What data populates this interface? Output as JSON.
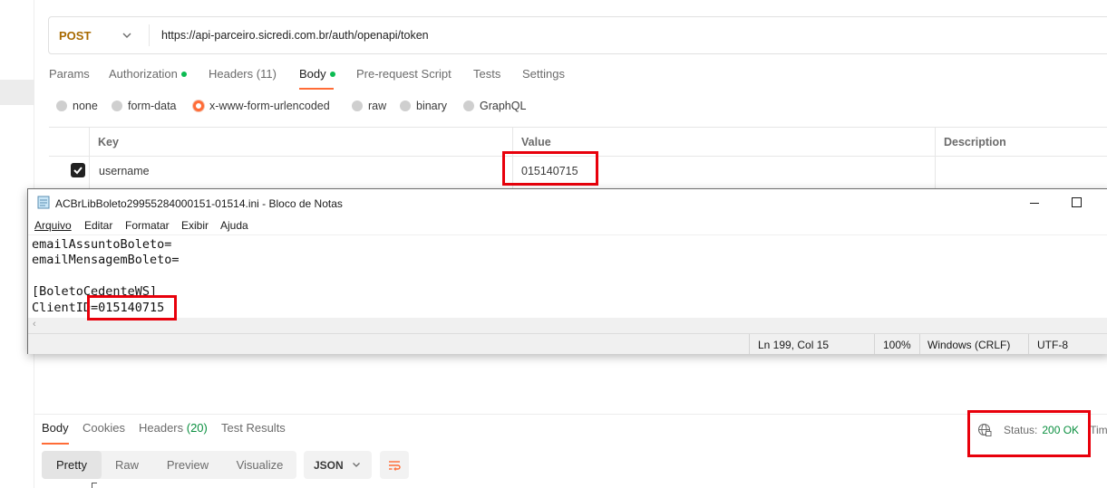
{
  "request": {
    "method": "POST",
    "url": "https://api-parceiro.sicredi.com.br/auth/openapi/token",
    "tabs": [
      {
        "label": "Params",
        "dot": false
      },
      {
        "label": "Authorization",
        "dot": true
      },
      {
        "label": "Headers (11)",
        "dot": false
      },
      {
        "label": "Body",
        "dot": true,
        "active": true
      },
      {
        "label": "Pre-request Script",
        "dot": false
      },
      {
        "label": "Tests",
        "dot": false
      },
      {
        "label": "Settings",
        "dot": false
      }
    ],
    "body_types": [
      "none",
      "form-data",
      "x-www-form-urlencoded",
      "raw",
      "binary",
      "GraphQL"
    ],
    "body_type_selected": "x-www-form-urlencoded",
    "params_table": {
      "headers": [
        "Key",
        "Value",
        "Description"
      ],
      "rows": [
        {
          "checked": true,
          "key": "username",
          "value": "015140715",
          "description": ""
        }
      ]
    }
  },
  "notepad": {
    "title": "ACBrLibBoleto29955284000151-01514.ini - Bloco de Notas",
    "menu": [
      "Arquivo",
      "Editar",
      "Formatar",
      "Exibir",
      "Ajuda"
    ],
    "lines": [
      "emailAssuntoBoleto=",
      "emailMensagemBoleto=",
      "",
      "[BoletoCedenteWS]",
      "ClientID=015140715"
    ],
    "status": {
      "position": "Ln 199, Col 15",
      "zoom": "100%",
      "line_ending": "Windows (CRLF)",
      "encoding": "UTF-8"
    }
  },
  "response": {
    "tabs": [
      {
        "label": "Body",
        "count": ""
      },
      {
        "label": "Cookies",
        "count": ""
      },
      {
        "label": "Headers ",
        "count": "(20)"
      },
      {
        "label": "Test Results",
        "count": ""
      }
    ],
    "status_label": "Status:",
    "status_code": "200 OK",
    "time_label": "Time",
    "view_modes": [
      "Pretty",
      "Raw",
      "Preview",
      "Visualize"
    ],
    "format": "JSON"
  },
  "colors": {
    "accent": "#ff6c37",
    "method": "#a86a00",
    "success": "#0a8f3f",
    "highlight": "#e8000b"
  },
  "icons": [
    "chevron-down-icon",
    "checkbox-checked-icon",
    "notepad-icon",
    "minimize-icon",
    "maximize-icon",
    "globe-icon",
    "wrap-lines-icon"
  ]
}
